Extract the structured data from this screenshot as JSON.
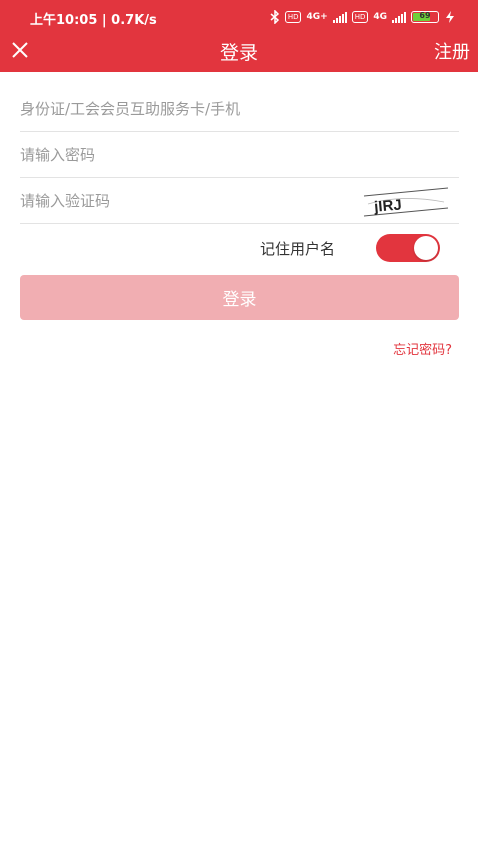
{
  "status_bar": {
    "time_speed": "上午10:05 | 0.7K/s",
    "hd": "HD",
    "network_1": "4G+",
    "network_2": "4G",
    "battery": "69"
  },
  "header": {
    "title": "登录",
    "register_label": "注册",
    "close_icon": "close-icon",
    "background_color": "#e2353e"
  },
  "form": {
    "account_placeholder": "身份证/工会会员互助服务卡/手机",
    "password_placeholder": "请输入密码",
    "captcha_placeholder": "请输入验证码",
    "captcha_text": "jIRJ"
  },
  "remember": {
    "label": "记住用户名",
    "checked": true
  },
  "login_button": {
    "label": "登录",
    "color": "#f1aeb2"
  },
  "forgot_password": "忘记密码?"
}
